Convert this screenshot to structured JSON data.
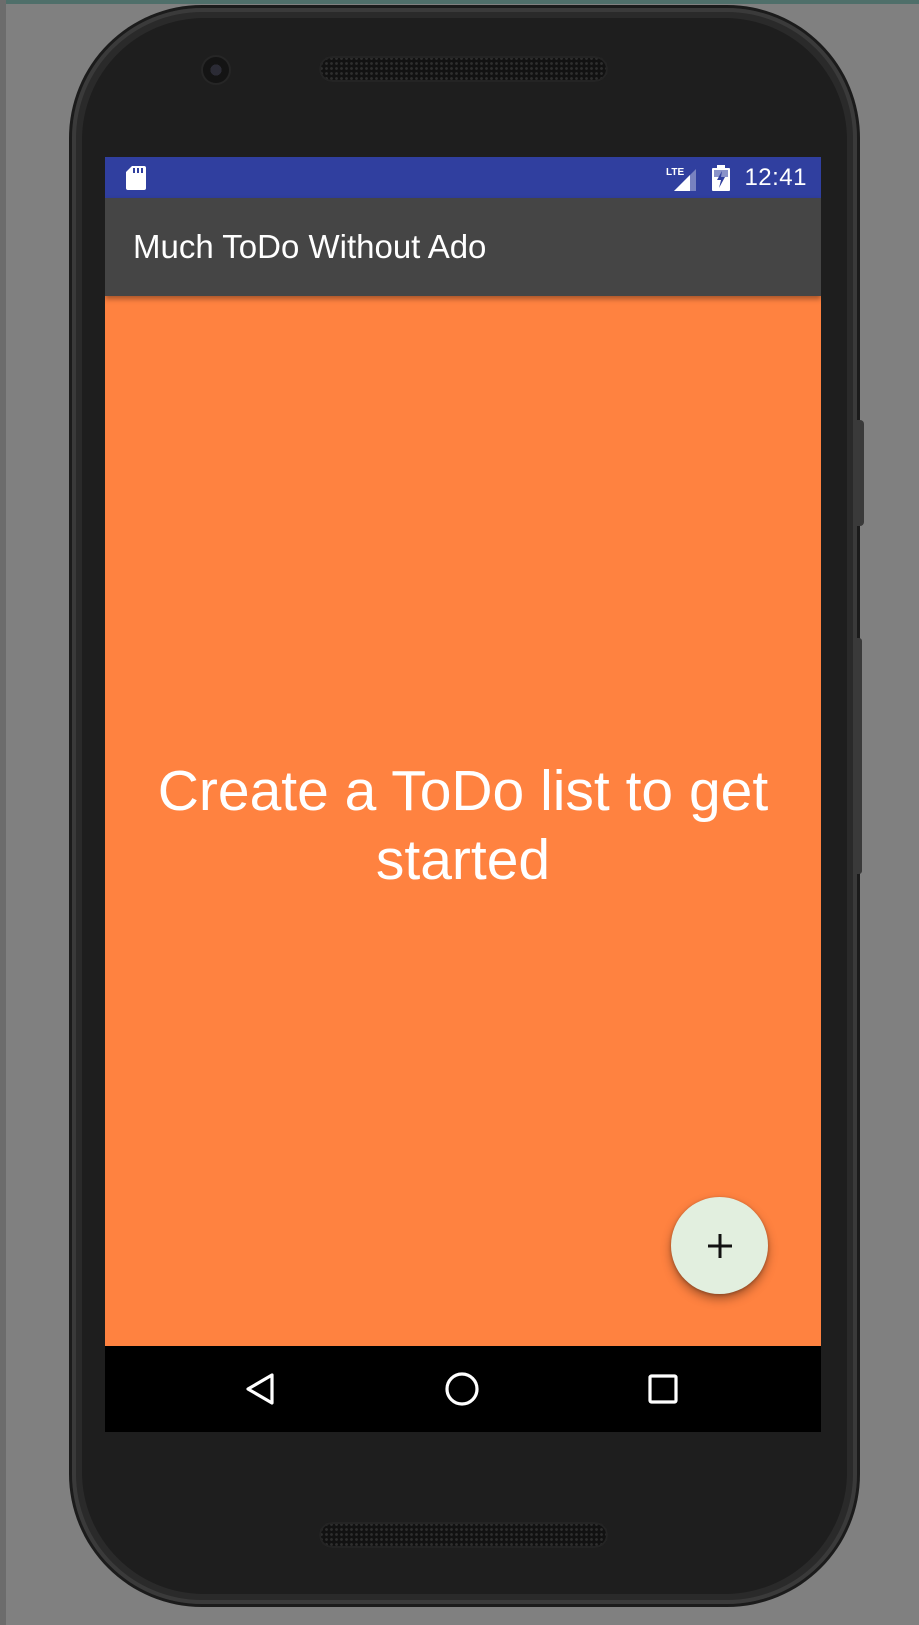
{
  "status_bar": {
    "time": "12:41",
    "color": "#303f9f",
    "icons": [
      "sd-card-icon",
      "lte-signal-icon",
      "battery-charging-icon"
    ]
  },
  "app_bar": {
    "title": "Much ToDo Without Ado",
    "color": "#454545"
  },
  "main": {
    "background_color": "#ff8240",
    "empty_message": "Create a ToDo list to get started"
  },
  "fab": {
    "icon": "plus-icon",
    "color": "#e2efdf"
  },
  "nav_bar": {
    "buttons": [
      "back-icon",
      "home-icon",
      "recents-icon"
    ]
  }
}
